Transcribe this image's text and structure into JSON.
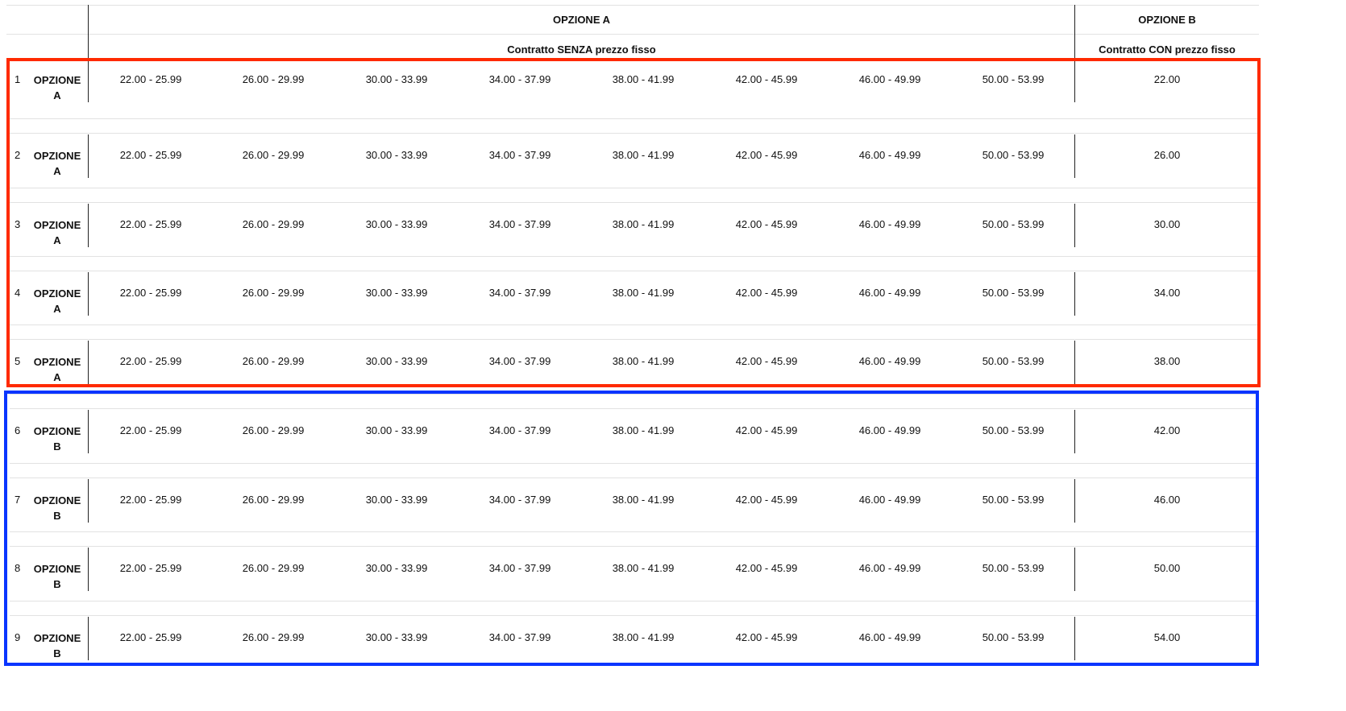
{
  "header": {
    "option_a_title": "OPZIONE A",
    "option_b_title": "OPZIONE B",
    "option_a_subtitle": "Contratto SENZA prezzo fisso",
    "option_b_subtitle": "Contratto CON prezzo fisso"
  },
  "ranges": [
    "22.00 - 25.99",
    "26.00 - 29.99",
    "30.00 - 33.99",
    "34.00 - 37.99",
    "38.00 - 41.99",
    "42.00 - 45.99",
    "46.00 - 49.99",
    "50.00 - 53.99"
  ],
  "rows": [
    {
      "num": "1",
      "opt_line1": "OPZIONE",
      "opt_line2": "A",
      "fixed": "22.00"
    },
    {
      "num": "2",
      "opt_line1": "OPZIONE",
      "opt_line2": "A",
      "fixed": "26.00"
    },
    {
      "num": "3",
      "opt_line1": "OPZIONE",
      "opt_line2": "A",
      "fixed": "30.00"
    },
    {
      "num": "4",
      "opt_line1": "OPZIONE",
      "opt_line2": "A",
      "fixed": "34.00"
    },
    {
      "num": "5",
      "opt_line1": "OPZIONE",
      "opt_line2": "A",
      "fixed": "38.00"
    },
    {
      "num": "6",
      "opt_line1": "OPZIONE",
      "opt_line2": "B",
      "fixed": "42.00"
    },
    {
      "num": "7",
      "opt_line1": "OPZIONE",
      "opt_line2": "B",
      "fixed": "46.00"
    },
    {
      "num": "8",
      "opt_line1": "OPZIONE",
      "opt_line2": "B",
      "fixed": "50.00"
    },
    {
      "num": "9",
      "opt_line1": "OPZIONE",
      "opt_line2": "B",
      "fixed": "54.00"
    }
  ],
  "colors": {
    "group_a_frame": "#ff2a00",
    "group_b_frame": "#0a35ff"
  }
}
